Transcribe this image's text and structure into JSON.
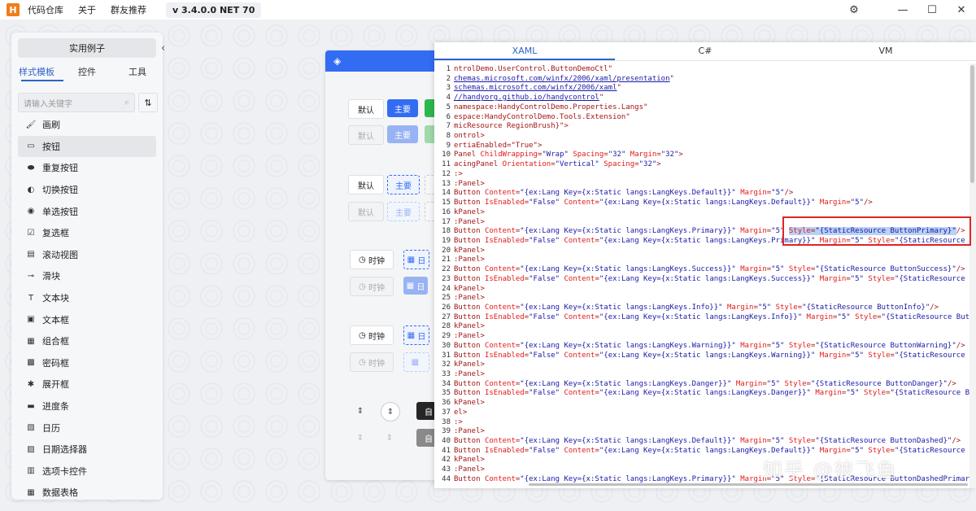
{
  "titlebar": {
    "logo": "H",
    "menu": [
      "代码仓库",
      "关于",
      "群友推荐"
    ],
    "version": "v 3.4.0.0 NET 70"
  },
  "leftpanel": {
    "examples_button": "实用例子",
    "tabs": [
      "样式模板",
      "控件",
      "工具"
    ],
    "search_placeholder": "请输入关键字",
    "items": [
      {
        "label": "画刷",
        "icon": "brush-icon"
      },
      {
        "label": "按钮",
        "icon": "button-icon",
        "selected": true
      },
      {
        "label": "重复按钮",
        "icon": "repeat-button-icon"
      },
      {
        "label": "切换按钮",
        "icon": "toggle-icon"
      },
      {
        "label": "单选按钮",
        "icon": "radio-icon"
      },
      {
        "label": "复选框",
        "icon": "checkbox-icon"
      },
      {
        "label": "滚动视图",
        "icon": "scrollviewer-icon"
      },
      {
        "label": "滑块",
        "icon": "slider-icon"
      },
      {
        "label": "文本块",
        "icon": "textblock-icon"
      },
      {
        "label": "文本框",
        "icon": "textbox-icon"
      },
      {
        "label": "组合框",
        "icon": "combobox-icon"
      },
      {
        "label": "密码框",
        "icon": "password-icon"
      },
      {
        "label": "展开框",
        "icon": "expander-icon"
      },
      {
        "label": "进度条",
        "icon": "progressbar-icon"
      },
      {
        "label": "日历",
        "icon": "calendar-icon"
      },
      {
        "label": "日期选择器",
        "icon": "datepicker-icon"
      },
      {
        "label": "选项卡控件",
        "icon": "tabcontrol-icon"
      },
      {
        "label": "数据表格",
        "icon": "datagrid-icon"
      }
    ]
  },
  "demo": {
    "default_label": "默认",
    "primary_label": "主要",
    "clock_label": "时钟",
    "calendar_label": "日",
    "dark_label": "自"
  },
  "code": {
    "tabs": [
      "XAML",
      "C#",
      "VM"
    ],
    "lines": [
      {
        "n": "1",
        "html": "ntrolDemo.UserControl.ButtonDemoCtl\""
      },
      {
        "n": "2",
        "html": "<span class='u'>chemas.microsoft.com/winfx/2006/xaml/presentation</span>\""
      },
      {
        "n": "3",
        "html": "<span class='u'>schemas.microsoft.com/winfx/2006/xaml</span>\""
      },
      {
        "n": "4",
        "html": "<span class='u'>//handyorg.github.io/handycontrol</span>\""
      },
      {
        "n": "5",
        "html": "namespace:HandyControlDemo.Properties.Langs\""
      },
      {
        "n": "6",
        "html": "espace:HandyControlDemo.Tools.Extension\""
      },
      {
        "n": "7",
        "html": "micResource RegionBrush}\">"
      },
      {
        "n": "8",
        "html": "ontrol>"
      },
      {
        "n": "9",
        "html": "ertiaEnabled=\"True\">"
      },
      {
        "n": "10",
        "html": "Panel <span class='at'>ChildWrapping</span>=<span class='av'>\"Wrap\"</span> <span class='at'>Spacing</span>=<span class='av'>\"32\"</span> <span class='at'>Margin</span>=<span class='av'>\"32\"</span>>"
      },
      {
        "n": "11",
        "html": "acingPanel <span class='at'>Orientation</span>=<span class='av'>\"Vertical\"</span> <span class='at'>Spacing</span>=<span class='av'>\"32\"</span>>"
      },
      {
        "n": "12",
        "html": ":>"
      },
      {
        "n": "13",
        "html": ":Panel>"
      },
      {
        "n": "14",
        "html": "Button <span class='at'>Content</span>=<span class='av'>\"{ex:Lang Key={x:Static langs:LangKeys.Default}}\"</span> <span class='at'>Margin</span>=<span class='av'>\"5\"</span>/>"
      },
      {
        "n": "15",
        "html": "Button <span class='at'>IsEnabled</span>=<span class='av'>\"False\"</span> <span class='at'>Content</span>=<span class='av'>\"{ex:Lang Key={x:Static langs:LangKeys.Default}}\"</span> <span class='at'>Margin</span>=<span class='av'>\"5\"</span>/>"
      },
      {
        "n": "16",
        "html": "kPanel>"
      },
      {
        "n": "17",
        "html": ":Panel>"
      },
      {
        "n": "18",
        "html": "Button <span class='at'>Content</span>=<span class='av'>\"{ex:Lang Key={x:Static langs:LangKeys.Primary}}\"</span> <span class='at'>Margin</span>=<span class='av'>\"5\"</span> <span class='hl'><span class='at'>Style</span>=<span class='av'>\"{StaticResource ButtonPrimary}\"</span></span>/>"
      },
      {
        "n": "19",
        "html": "Button <span class='at'>IsEnabled</span>=<span class='av'>\"False\"</span> <span class='at'>Content</span>=<span class='av'>\"{ex:Lang Key={x:Static langs:LangKeys.Primary}}\"</span> <span class='at'>Margin</span>=<span class='av'>\"5\"</span> <span class='at'>Style</span>=<span class='av'>\"{StaticResource</span>"
      },
      {
        "n": "20",
        "html": "kPanel>"
      },
      {
        "n": "21",
        "html": ":Panel>"
      },
      {
        "n": "22",
        "html": "Button <span class='at'>Content</span>=<span class='av'>\"{ex:Lang Key={x:Static langs:LangKeys.Success}}\"</span> <span class='at'>Margin</span>=<span class='av'>\"5\"</span> <span class='at'>Style</span>=<span class='av'>\"{StaticResource ButtonSuccess}\"</span>/>"
      },
      {
        "n": "23",
        "html": "Button <span class='at'>IsEnabled</span>=<span class='av'>\"False\"</span> <span class='at'>Content</span>=<span class='av'>\"{ex:Lang Key={x:Static langs:LangKeys.Success}}\"</span> <span class='at'>Margin</span>=<span class='av'>\"5\"</span> <span class='at'>Style</span>=<span class='av'>\"{StaticResource</span>"
      },
      {
        "n": "24",
        "html": "kPanel>"
      },
      {
        "n": "25",
        "html": ":Panel>"
      },
      {
        "n": "26",
        "html": "Button <span class='at'>Content</span>=<span class='av'>\"{ex:Lang Key={x:Static langs:LangKeys.Info}}\"</span> <span class='at'>Margin</span>=<span class='av'>\"5\"</span> <span class='at'>Style</span>=<span class='av'>\"{StaticResource ButtonInfo}\"</span>/>"
      },
      {
        "n": "27",
        "html": "Button <span class='at'>IsEnabled</span>=<span class='av'>\"False\"</span> <span class='at'>Content</span>=<span class='av'>\"{ex:Lang Key={x:Static langs:LangKeys.Info}}\"</span> <span class='at'>Margin</span>=<span class='av'>\"5\"</span> <span class='at'>Style</span>=<span class='av'>\"{StaticResource But</span>"
      },
      {
        "n": "28",
        "html": "kPanel>"
      },
      {
        "n": "29",
        "html": ":Panel>"
      },
      {
        "n": "30",
        "html": "Button <span class='at'>Content</span>=<span class='av'>\"{ex:Lang Key={x:Static langs:LangKeys.Warning}}\"</span> <span class='at'>Margin</span>=<span class='av'>\"5\"</span> <span class='at'>Style</span>=<span class='av'>\"{StaticResource ButtonWarning}\"</span>/>"
      },
      {
        "n": "31",
        "html": "Button <span class='at'>IsEnabled</span>=<span class='av'>\"False\"</span> <span class='at'>Content</span>=<span class='av'>\"{ex:Lang Key={x:Static langs:LangKeys.Warning}}\"</span> <span class='at'>Margin</span>=<span class='av'>\"5\"</span> <span class='at'>Style</span>=<span class='av'>\"{StaticResource</span>"
      },
      {
        "n": "32",
        "html": "kPanel>"
      },
      {
        "n": "33",
        "html": ":Panel>"
      },
      {
        "n": "34",
        "html": "Button <span class='at'>Content</span>=<span class='av'>\"{ex:Lang Key={x:Static langs:LangKeys.Danger}}\"</span> <span class='at'>Margin</span>=<span class='av'>\"5\"</span> <span class='at'>Style</span>=<span class='av'>\"{StaticResource ButtonDanger}\"</span>/>"
      },
      {
        "n": "35",
        "html": "Button <span class='at'>IsEnabled</span>=<span class='av'>\"False\"</span> <span class='at'>Content</span>=<span class='av'>\"{ex:Lang Key={x:Static langs:LangKeys.Danger}}\"</span> <span class='at'>Margin</span>=<span class='av'>\"5\"</span> <span class='at'>Style</span>=<span class='av'>\"{StaticResource B</span>"
      },
      {
        "n": "36",
        "html": "kPanel>"
      },
      {
        "n": "37",
        "html": "el>"
      },
      {
        "n": "38",
        "html": ":>"
      },
      {
        "n": "39",
        "html": ":Panel>"
      },
      {
        "n": "40",
        "html": "Button <span class='at'>Content</span>=<span class='av'>\"{ex:Lang Key={x:Static langs:LangKeys.Default}}\"</span> <span class='at'>Margin</span>=<span class='av'>\"5\"</span> <span class='at'>Style</span>=<span class='av'>\"{StaticResource ButtonDashed}\"</span>/>"
      },
      {
        "n": "41",
        "html": "Button <span class='at'>IsEnabled</span>=<span class='av'>\"False\"</span> <span class='at'>Content</span>=<span class='av'>\"{ex:Lang Key={x:Static langs:LangKeys.Default}}\"</span> <span class='at'>Margin</span>=<span class='av'>\"5\"</span> <span class='at'>Style</span>=<span class='av'>\"{StaticResource</span>"
      },
      {
        "n": "42",
        "html": "kPanel>"
      },
      {
        "n": "43",
        "html": ":Panel>"
      },
      {
        "n": "44",
        "html": "Button <span class='at'>Content</span>=<span class='av'>\"{ex:Lang Key={x:Static langs:LangKeys.Primary}}\"</span> <span class='at'>Margin</span>=<span class='av'>\"5\"</span> <span class='at'>Style</span>=<span class='av'>\"{StaticResource ButtonDashedPrimar</span>"
      }
    ]
  },
  "watermark": "知乎 @彼飞鱼"
}
